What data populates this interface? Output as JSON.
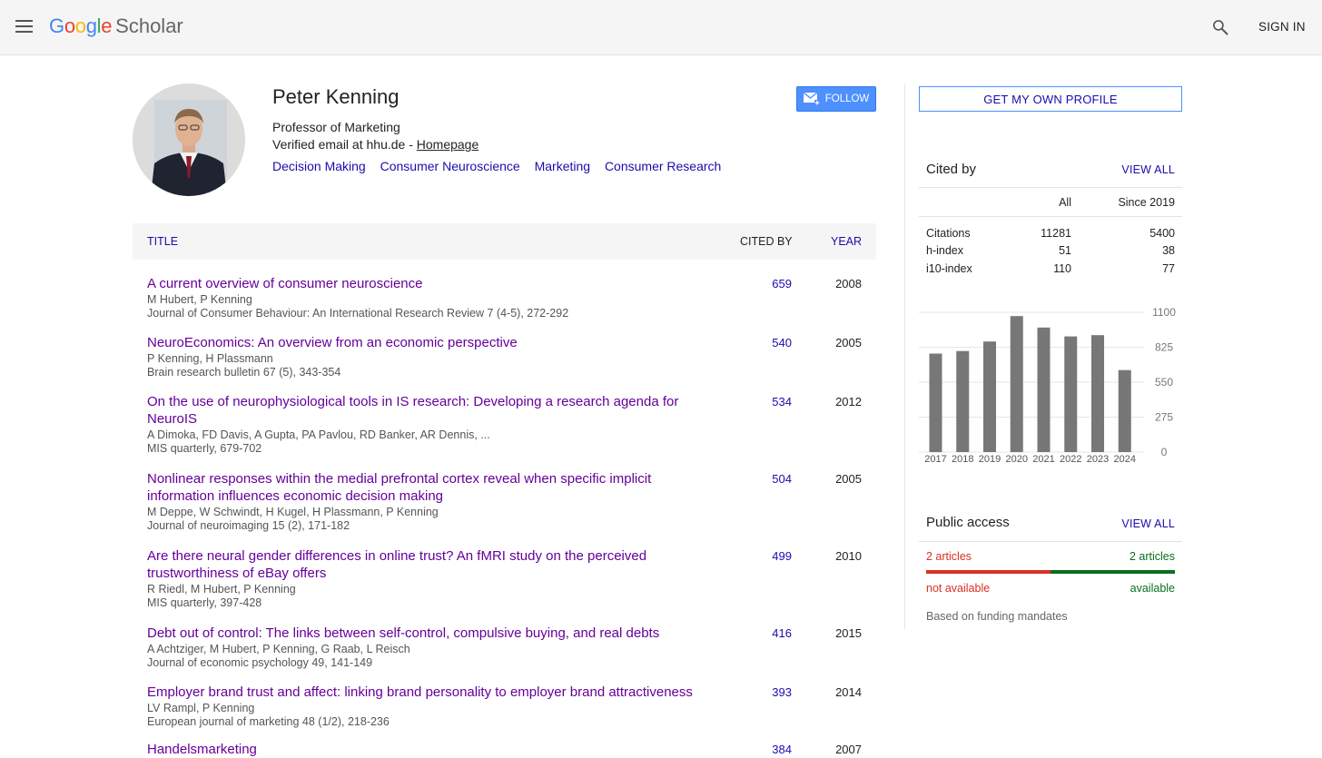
{
  "header": {
    "logo_google": "Google",
    "logo_scholar": "Scholar",
    "signin_label": "SIGN IN"
  },
  "profile": {
    "name": "Peter Kenning",
    "affiliation": "Professor of Marketing",
    "email_text": "Verified email at hhu.de - ",
    "homepage_label": "Homepage",
    "interests": [
      "Decision Making",
      "Consumer Neuroscience",
      "Marketing",
      "Consumer Research"
    ],
    "follow_label": "FOLLOW"
  },
  "table": {
    "col_title": "TITLE",
    "col_cited": "CITED BY",
    "col_year": "YEAR",
    "rows": [
      {
        "title": "A current overview of consumer neuroscience",
        "authors": "M Hubert, P Kenning",
        "venue": "Journal of Consumer Behaviour: An International Research Review 7 (4-5), 272-292",
        "cited": "659",
        "year": "2008"
      },
      {
        "title": "NeuroEconomics: An overview from an economic perspective",
        "authors": "P Kenning, H Plassmann",
        "venue": "Brain research bulletin 67 (5), 343-354",
        "cited": "540",
        "year": "2005"
      },
      {
        "title": "On the use of neurophysiological tools in IS research: Developing a research agenda for NeuroIS",
        "authors": "A Dimoka, FD Davis, A Gupta, PA Pavlou, RD Banker, AR Dennis, ...",
        "venue": "MIS quarterly, 679-702",
        "cited": "534",
        "year": "2012"
      },
      {
        "title": "Nonlinear responses within the medial prefrontal cortex reveal when specific implicit information influences economic decision making",
        "authors": "M Deppe, W Schwindt, H Kugel, H Plassmann, P Kenning",
        "venue": "Journal of neuroimaging 15 (2), 171-182",
        "cited": "504",
        "year": "2005"
      },
      {
        "title": "Are there neural gender differences in online trust? An fMRI study on the perceived trustworthiness of eBay offers",
        "authors": "R Riedl, M Hubert, P Kenning",
        "venue": "MIS quarterly, 397-428",
        "cited": "499",
        "year": "2010"
      },
      {
        "title": "Debt out of control: The links between self-control, compulsive buying, and real debts",
        "authors": "A Achtziger, M Hubert, P Kenning, G Raab, L Reisch",
        "venue": "Journal of economic psychology 49, 141-149",
        "cited": "416",
        "year": "2015"
      },
      {
        "title": "Employer brand trust and affect: linking brand personality to employer brand attractiveness",
        "authors": "LV Rampl, P Kenning",
        "venue": "European journal of marketing 48 (1/2), 218-236",
        "cited": "393",
        "year": "2014"
      },
      {
        "title": "Handelsmarketing",
        "authors": "",
        "venue": "",
        "cited": "384",
        "year": "2007"
      }
    ]
  },
  "sidebar": {
    "get_profile_label": "GET MY OWN PROFILE",
    "cited_by": {
      "title": "Cited by",
      "view_all": "VIEW ALL",
      "col_all": "All",
      "col_since": "Since 2019",
      "stats": [
        {
          "label": "Citations",
          "all": "11281",
          "since": "5400"
        },
        {
          "label": "h-index",
          "all": "51",
          "since": "38"
        },
        {
          "label": "i10-index",
          "all": "110",
          "since": "77"
        }
      ]
    },
    "public_access": {
      "title": "Public access",
      "view_all": "VIEW ALL",
      "not_available_count": "2 articles",
      "available_count": "2 articles",
      "not_available_label": "not available",
      "available_label": "available",
      "note": "Based on funding mandates",
      "red_color": "#d93025",
      "green_color": "#0b6e1d",
      "available_fraction": 0.5
    }
  },
  "chart_data": {
    "type": "bar",
    "categories": [
      "2017",
      "2018",
      "2019",
      "2020",
      "2021",
      "2022",
      "2023",
      "2024"
    ],
    "values": [
      775,
      795,
      870,
      1070,
      980,
      910,
      920,
      645
    ],
    "ylim": [
      0,
      1100
    ],
    "yticks": [
      "1100",
      "825",
      "550",
      "275",
      "0"
    ],
    "bar_color": "#777777",
    "grid": true
  }
}
